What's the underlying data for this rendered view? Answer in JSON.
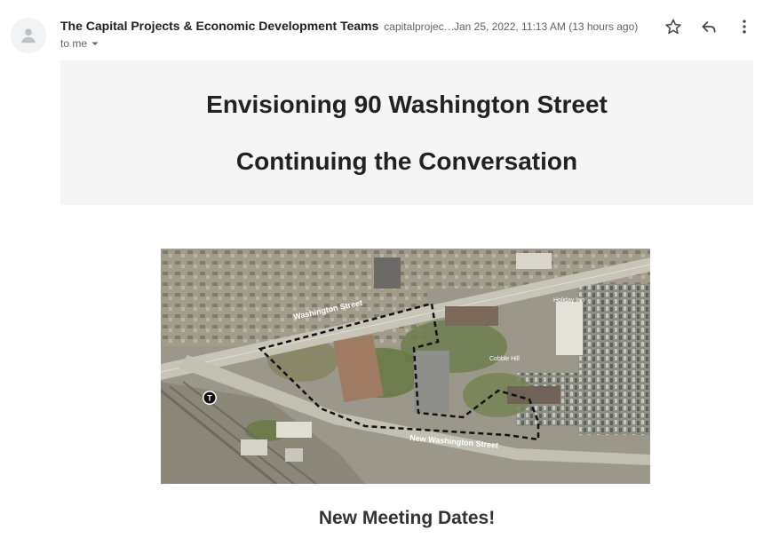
{
  "email": {
    "sender_name": "The Capital Projects & Economic Development Teams",
    "sender_email": "capitalprojec…",
    "date": "Jan 25, 2022, 11:13 AM (13 hours ago)",
    "to": "to me"
  },
  "icons": {
    "avatar": "person-icon",
    "star": "star-icon",
    "reply": "reply-icon",
    "more": "more-vert-icon",
    "to_dropdown": "caret-down-icon"
  },
  "banner": {
    "title": "Envisioning 90 Washington Street",
    "subtitle": "Continuing the Conversation",
    "background": "#f5f5f5"
  },
  "map": {
    "street_top": "Washington Street",
    "street_bottom": "New Washington Street",
    "cobble_hill": "Cobble Hill",
    "holiday_inn": "Holiday Inn",
    "transit_marker": "T"
  },
  "section": {
    "heading": "New Meeting Dates!"
  }
}
